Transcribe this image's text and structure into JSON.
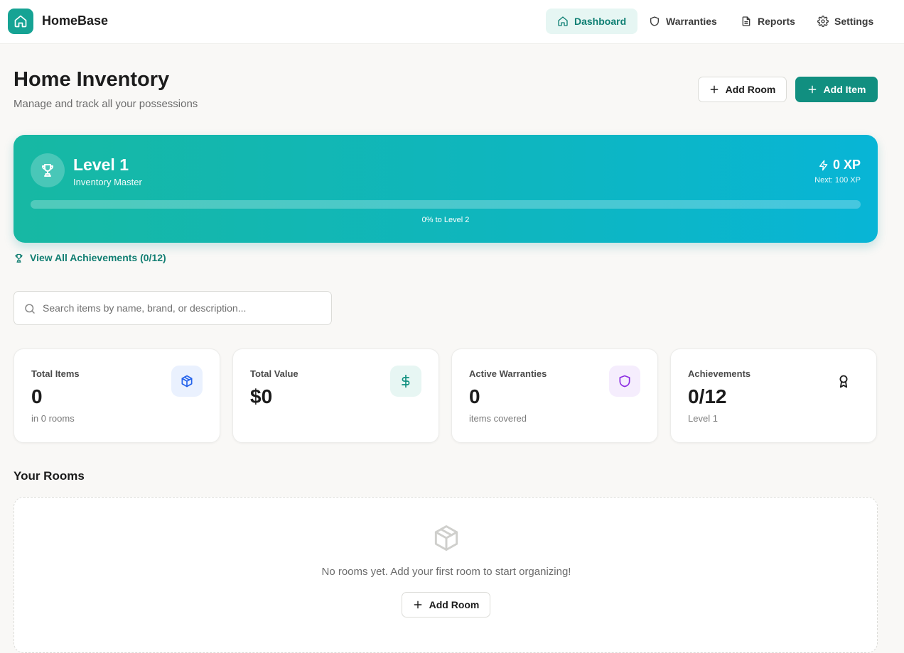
{
  "app": {
    "brand": "HomeBase"
  },
  "nav": [
    {
      "label": "Dashboard",
      "icon": "home-icon",
      "active": true
    },
    {
      "label": "Warranties",
      "icon": "shield-icon",
      "active": false
    },
    {
      "label": "Reports",
      "icon": "document-icon",
      "active": false
    },
    {
      "label": "Settings",
      "icon": "gear-icon",
      "active": false
    }
  ],
  "header": {
    "title": "Home Inventory",
    "subtitle": "Manage and track all your possessions",
    "add_room_label": "Add Room",
    "add_item_label": "Add Item"
  },
  "level": {
    "title": "Level 1",
    "rank": "Inventory Master",
    "xp": "0 XP",
    "next": "Next: 100 XP",
    "progress_percent": 0,
    "progress_label": "0% to Level 2"
  },
  "achievements_link": "View All Achievements (0/12)",
  "search": {
    "placeholder": "Search items by name, brand, or description...",
    "value": ""
  },
  "stats": [
    {
      "label": "Total Items",
      "value": "0",
      "note": "in 0 rooms",
      "icon": "box-icon",
      "color": "#2563eb"
    },
    {
      "label": "Total Value",
      "value": "$0",
      "note": "",
      "icon": "dollar-icon",
      "color": "#0f8f7f"
    },
    {
      "label": "Active Warranties",
      "value": "0",
      "note": "items covered",
      "icon": "shield-icon",
      "color": "#8b2be2"
    },
    {
      "label": "Achievements",
      "value": "0/12",
      "note": "Level 1",
      "icon": "award-icon",
      "color": "#1c1c1c"
    }
  ],
  "rooms": {
    "title": "Your Rooms",
    "empty_text": "No rooms yet. Add your first room to start organizing!",
    "add_room_label": "Add Room"
  },
  "colors": {
    "accent": "#118f80",
    "gradient_start": "#17b8a3",
    "gradient_end": "#08b5d6",
    "background": "#f9f8f6"
  }
}
